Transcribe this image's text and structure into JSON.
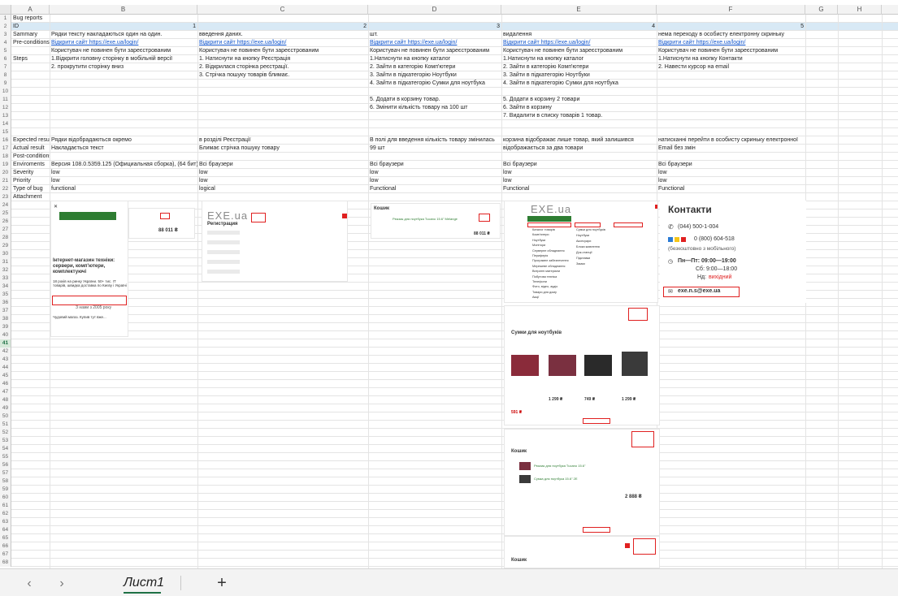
{
  "columns": [
    "A",
    "B",
    "C",
    "D",
    "E",
    "F",
    "G",
    "H"
  ],
  "rows": [
    {
      "n": "1",
      "a": "Bug reports",
      "b": "",
      "c": "",
      "d": "",
      "e": "",
      "f": ""
    },
    {
      "n": "2",
      "a": "ID",
      "b": "1",
      "c": "2",
      "d": "3",
      "e": "4",
      "f": "5"
    },
    {
      "n": "3",
      "a": "Sammary",
      "b": "Рядки тексту накладаються один на один.",
      "c": "введення даних.",
      "d": "шт.",
      "e": "видалення",
      "f": "нема переходу в особисту електронну скриньку"
    },
    {
      "n": "4",
      "a": "Pre-conditions",
      "b": "Відкрити сайт https://exe.ua/login/",
      "c": "Відкрити сайт https://exe.ua/login/",
      "d": "Відкрити сайт https://exe.ua/login/",
      "e": "Відкрити сайт https://exe.ua/login/",
      "f": "Відкрити сайт https://exe.ua/login/"
    },
    {
      "n": "5",
      "a": "",
      "b": "Користувач не повинен бути зареєстрованим",
      "c": "Користувач не повинен бути зареєстрованим",
      "d": "Користувач не повинен бути зареєстрованим",
      "e": "Користувач не повинен бути зареєстрованим",
      "f": "Користувач не повинен бути зареєстрованим"
    },
    {
      "n": "6",
      "a": "Steps",
      "b": "1.Відкрити головну сторінку в мобільній версії",
      "c": "1. Натиснути на кнопку Реєстрація",
      "d": "1.Натиснути на кнопку каталог",
      "e": "1.Натиснути на кнопку каталог",
      "f": "1.Натиснути на кнопку Контакти"
    },
    {
      "n": "7",
      "a": "",
      "b": "2. прокрутити сторінку вниз",
      "c": "2. Відкрилася сторінка реєстрації.",
      "d": "2. Зайти в категорію Комп'ютери",
      "e": "2. Зайти в категорію Комп'ютери",
      "f": "2. Навести курсор на email"
    },
    {
      "n": "8",
      "a": "",
      "b": "",
      "c": "3. Стрічка пошуку товарів блимає.",
      "d": "3. Зайти в підкатегорію Ноутбуки",
      "e": "3. Зайти в підкатегорію Ноутбуки",
      "f": ""
    },
    {
      "n": "9",
      "a": "",
      "b": "",
      "c": "",
      "d": "4. Зайти в підкатегорію Сумки для ноутбука",
      "e": "4. Зайти в підкатегорію Сумки для ноутбука",
      "f": ""
    },
    {
      "n": "10",
      "a": "",
      "b": "",
      "c": "",
      "d": "",
      "e": "",
      "f": ""
    },
    {
      "n": "11",
      "a": "",
      "b": "",
      "c": "",
      "d": "5. Додати в корзину товар.",
      "e": "5. Додати в корзину 2 товари",
      "f": ""
    },
    {
      "n": "12",
      "a": "",
      "b": "",
      "c": "",
      "d": "6. Змінити кількість товару на 100 шт",
      "e": "6. Зайти в корзину",
      "f": ""
    },
    {
      "n": "13",
      "a": "",
      "b": "",
      "c": "",
      "d": "",
      "e": "7. Видалити в списку товарів 1 товар.",
      "f": ""
    },
    {
      "n": "14",
      "a": "",
      "b": "",
      "c": "",
      "d": "",
      "e": "",
      "f": ""
    },
    {
      "n": "15",
      "a": "",
      "b": "",
      "c": "",
      "d": "",
      "e": "",
      "f": ""
    },
    {
      "n": "16",
      "a": "Expected result",
      "b": "Рядки відобрадаються окремо",
      "c": "в розділі Реєстрації",
      "d": "В полі для введення кількість товару змінилась",
      "e": "корзина відображає лише товар, який залишився",
      "f": "натисканні перейти в особисту скриньку електронної"
    },
    {
      "n": "17",
      "a": "Actual result",
      "b": "Накладається текст",
      "c": "Блимає стрічка пошуку товару",
      "d": "99 шт",
      "e": "відображається за два товари",
      "f": "Email без змін"
    },
    {
      "n": "18",
      "a": "Post-conditions",
      "b": "",
      "c": "",
      "d": "",
      "e": "",
      "f": ""
    },
    {
      "n": "19",
      "a": "Enviroments",
      "b": "Версия 108.0.5359.125 (Официальная сборка), (64 бит)",
      "c": "Всі браузери",
      "d": "Всі браузери",
      "e": "Всі браузери",
      "f": "Всі браузери"
    },
    {
      "n": "20",
      "a": "Severity",
      "b": "low",
      "c": "low",
      "d": "low",
      "e": "low",
      "f": "low"
    },
    {
      "n": "21",
      "a": "Priority",
      "b": "low",
      "c": "low",
      "d": "low",
      "e": "low",
      "f": "low"
    },
    {
      "n": "22",
      "a": "Type of bug",
      "b": "functional",
      "c": "logical",
      "d": "Functional",
      "e": "Functional",
      "f": "Functional"
    },
    {
      "n": "23",
      "a": "Attachment",
      "b": "",
      "c": "",
      "d": "",
      "e": "",
      "f": ""
    }
  ],
  "shots": {
    "mobile": {
      "title": "Інтернет-магазин техніки: сервери, комп'ютери, комплектуючі",
      "years": "18 років на ринку України. 50+ тис. IT товарів, швидка доставка по Києву і Україні",
      "since": "З нами з 2005 року",
      "price": "88 011 ₴",
      "review": "Чудовий магаз. Купив тут вже..."
    },
    "register": {
      "logo": "EXE.ua",
      "heading": "Регистрация"
    },
    "cart100": {
      "heading": "Кошик",
      "item": "Рюкзак для ноутбука Tucano 15.6\" Melange",
      "total": "88 011 ₴"
    },
    "catalog": {
      "logo": "EXE.ua",
      "menu": [
        "Каталог товарів",
        "Комп'ютери",
        "Ноутбуки",
        "Монітори",
        "Серверне обладнання",
        "Периферія",
        "Програмне забезпечення",
        "Мережеве обладнання",
        "Витратні матеріали",
        "Побутова техніка",
        "Телефони",
        "Фото, відео, аудіо",
        "Товари для дому",
        "Акції"
      ],
      "sub": [
        "Сумки для ноутбуків",
        "Ноутбуки",
        "Аксесуари",
        "Блоки живлення",
        "Док-станції",
        "Підставки",
        "Замки"
      ],
      "category": "Сумки для ноутбуків",
      "prices": [
        "591 ₴",
        "1 299 ₴",
        "749 ₴",
        "1 299 ₴"
      ],
      "cart_title": "Кошик",
      "cart_total": "2 888 ₴",
      "cart_items": [
        "Рюкзак для ноутбука Tucano 15.6\"",
        "Сумка для ноутбука 15.6\" 2E"
      ]
    },
    "contacts": {
      "title": "Контакти",
      "phone1": "(044) 500-1-004",
      "phone2": "0 (800) 604-518",
      "phone2_note": "(безкоштовно з мобільного)",
      "hours1": "Пн—Пт: 09:00—19:00",
      "hours2": "Сб: 9:00—18:00",
      "hours3_label": "Нд:",
      "hours3_value": "вихідний",
      "email": "exe.n.s@exe.ua"
    }
  },
  "tabbar": {
    "prev": "‹",
    "next": "›",
    "sheet_name": "Лист1",
    "add": "+"
  },
  "colors": {
    "accent": "#1e7145",
    "id_row": "#d8e9f5",
    "link": "#1155cc",
    "red": "#e02020"
  }
}
